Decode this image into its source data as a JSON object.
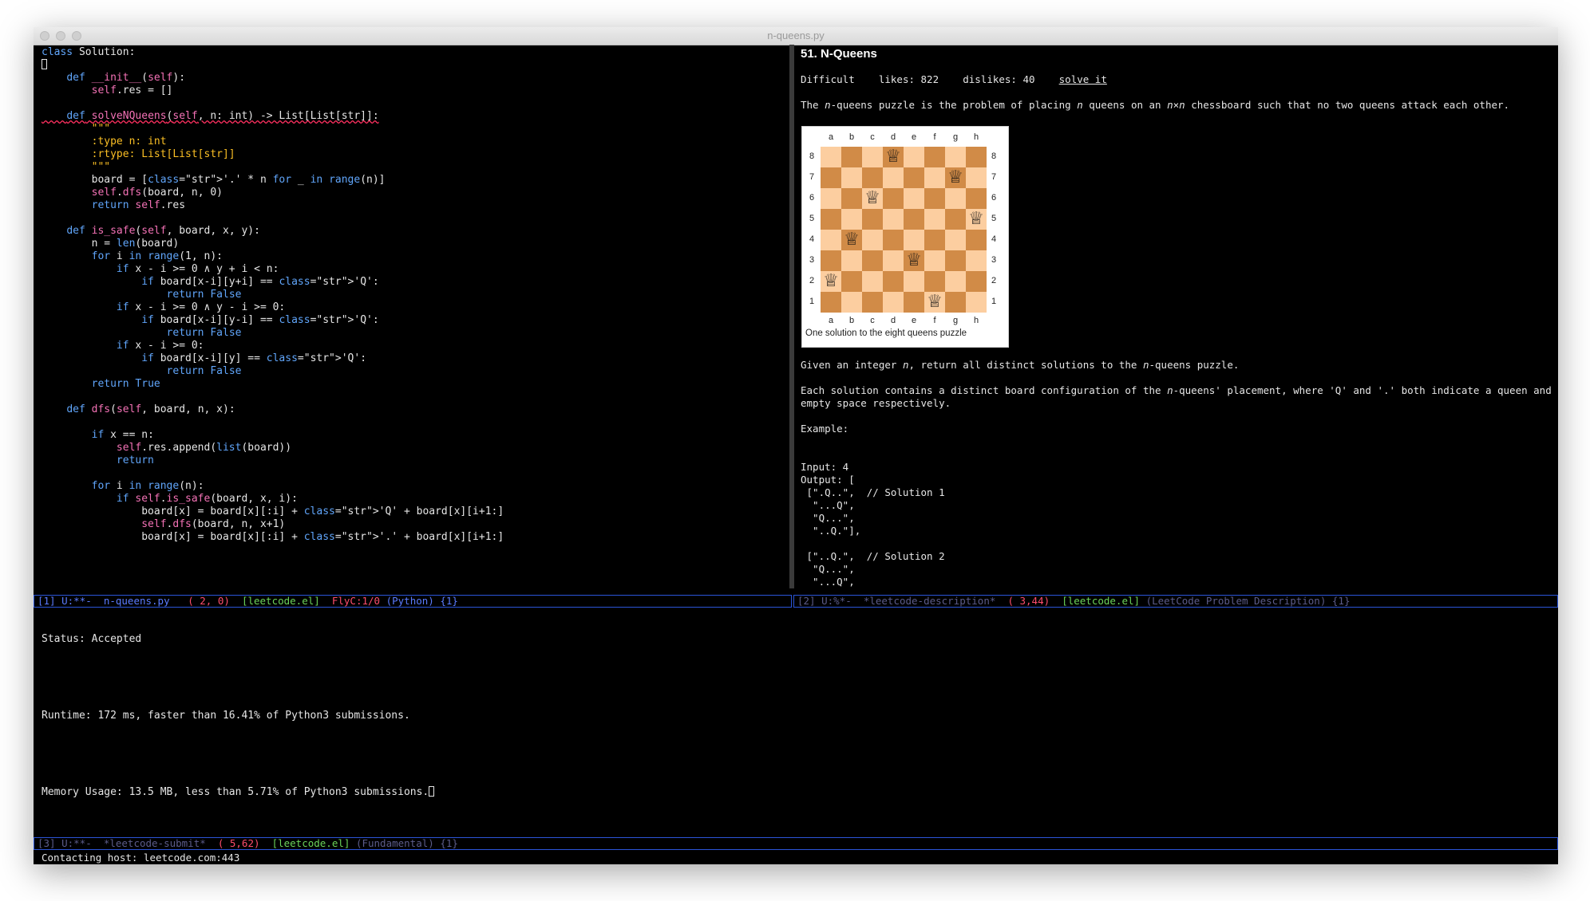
{
  "window": {
    "title": "n-queens.py"
  },
  "editor": {
    "lines": [
      "class Solution:",
      "",
      "    def __init__(self):",
      "        self.res = []",
      "",
      "    def solveNQueens(self, n: int) -> List[List[str]]:",
      "        \"\"\"",
      "        :type n: int",
      "        :rtype: List[List[str]]",
      "        \"\"\"",
      "        board = ['.' * n for _ in range(n)]",
      "        self.dfs(board, n, 0)",
      "        return self.res",
      "",
      "    def is_safe(self, board, x, y):",
      "        n = len(board)",
      "        for i in range(1, n):",
      "            if x - i >= 0 ∧ y + i < n:",
      "                if board[x-i][y+i] == 'Q':",
      "                    return False",
      "            if x - i >= 0 ∧ y - i >= 0:",
      "                if board[x-i][y-i] == 'Q':",
      "                    return False",
      "            if x - i >= 0:",
      "                if board[x-i][y] == 'Q':",
      "                    return False",
      "        return True",
      "",
      "    def dfs(self, board, n, x):",
      "",
      "        if x == n:",
      "            self.res.append(list(board))",
      "            return",
      "",
      "        for i in range(n):",
      "            if self.is_safe(board, x, i):",
      "                board[x] = board[x][:i] + 'Q' + board[x][i+1:]",
      "                self.dfs(board, n, x+1)",
      "                board[x] = board[x][:i] + '.' + board[x][i+1:]"
    ]
  },
  "modeline_left": {
    "buffer_num": "[1]",
    "state": "U:**-",
    "filename": "n-queens.py",
    "position": "( 2, 0)",
    "package": "[leetcode.el]",
    "flycheck": "FlyC:1/0",
    "mode": "(Python)",
    "extra": "{1}"
  },
  "modeline_right": {
    "buffer_num": "[2]",
    "state": "U:%*-",
    "filename": "*leetcode-description*",
    "position": "( 3,44)",
    "package": "[leetcode.el]",
    "mode": "(LeetCode Problem Description)",
    "extra": "{1}"
  },
  "modeline_bottom": {
    "buffer_num": "[3]",
    "state": "U:**-",
    "filename": "*leetcode-submit*",
    "position": "( 5,62)",
    "package": "[leetcode.el]",
    "mode": "(Fundamental)",
    "extra": "{1}"
  },
  "description": {
    "title": "51. N-Queens",
    "difficulty": "Difficult",
    "likes": "likes: 822",
    "dislikes": "dislikes: 40",
    "solve_link": "solve it",
    "intro_parts": [
      "The ",
      "n",
      "-queens puzzle is the problem of placing ",
      "n",
      " queens on an ",
      "n×n",
      " chessboard such that no two queens attack each other."
    ],
    "chess_caption": "One solution to the eight queens puzzle",
    "files": [
      "a",
      "b",
      "c",
      "d",
      "e",
      "f",
      "g",
      "h"
    ],
    "ranks": [
      "8",
      "7",
      "6",
      "5",
      "4",
      "3",
      "2",
      "1"
    ],
    "queens": [
      [
        0,
        3
      ],
      [
        1,
        6
      ],
      [
        2,
        2
      ],
      [
        3,
        7
      ],
      [
        4,
        1
      ],
      [
        5,
        4
      ],
      [
        6,
        0
      ],
      [
        7,
        5
      ]
    ],
    "given_parts": [
      "Given an integer ",
      "n",
      ", return all distinct solutions to the ",
      "n",
      "-queens puzzle."
    ],
    "each_parts": [
      "Each solution contains a distinct board configuration of the ",
      "n",
      "-queens' placement, where 'Q' and '.' both indicate a queen and an"
    ],
    "each_line2": "empty space respectively.",
    "example_label": "Example:",
    "example_lines": [
      "Input: 4",
      "Output: [",
      " [\".Q..\",  // Solution 1",
      "  \"...Q\",",
      "  \"Q...\",",
      "  \"..Q.\"],",
      "",
      " [\"..Q.\",  // Solution 2",
      "  \"Q...\",",
      "  \"...Q\","
    ]
  },
  "submit": {
    "status": "Status: Accepted",
    "runtime": "Runtime: 172 ms, faster than 16.41% of Python3 submissions.",
    "memory": "Memory Usage: 13.5 MB, less than 5.71% of Python3 submissions."
  },
  "echo_area": "Contacting host: leetcode.com:443"
}
